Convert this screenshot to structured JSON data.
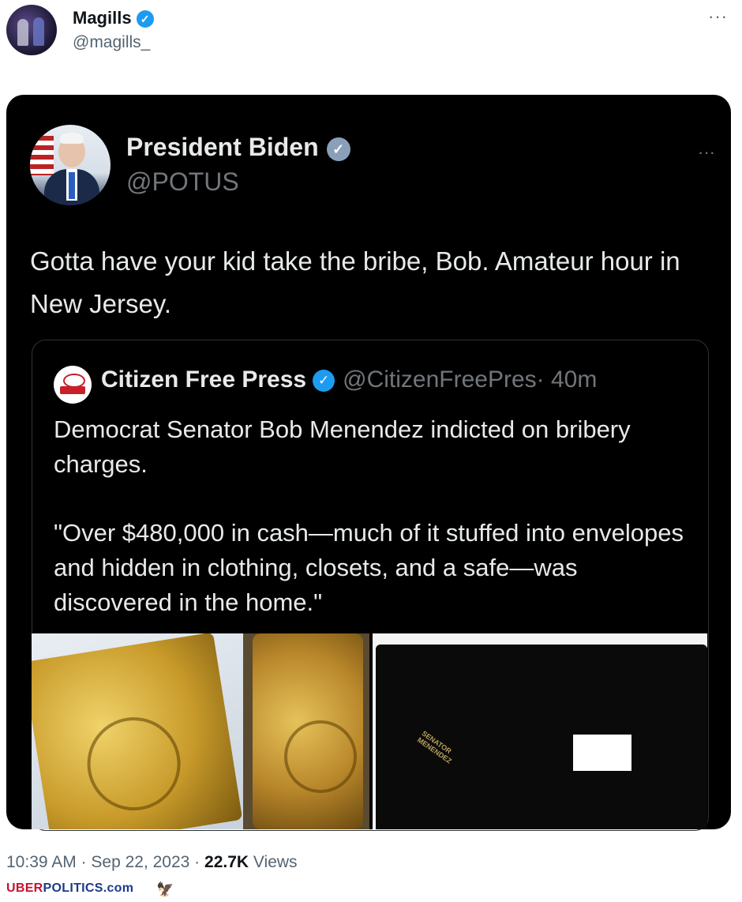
{
  "author": {
    "name": "Magills",
    "handle": "@magills_",
    "more_label": "···"
  },
  "embedded_tweet": {
    "name": "President Biden",
    "handle": "@POTUS",
    "more_label": "···",
    "text": "Gotta have your kid take the bribe, Bob. Amateur hour in New Jersey."
  },
  "quoted_tweet": {
    "name": "Citizen Free Press",
    "handle": "@CitizenFreePres",
    "age": "· 40m",
    "paragraph1": "Democrat Senator Bob Menendez indicted on bribery charges.",
    "paragraph2": "\"Over $480,000 in cash—much of it stuffed into envelopes and hidden in clothing, closets, and a safe—was discovered in the home.\""
  },
  "meta": {
    "time": "10:39 AM · Sep 22, 2023 ·",
    "views_count": "22.7K",
    "views_label": "Views"
  },
  "watermark": {
    "part1": "UBER",
    "part2": "POLITICS.com"
  },
  "colors": {
    "verified_blue": "#1d9bf0",
    "card_bg": "#000000",
    "watermark_red": "#c8102e",
    "watermark_blue": "#1a3a8a"
  }
}
